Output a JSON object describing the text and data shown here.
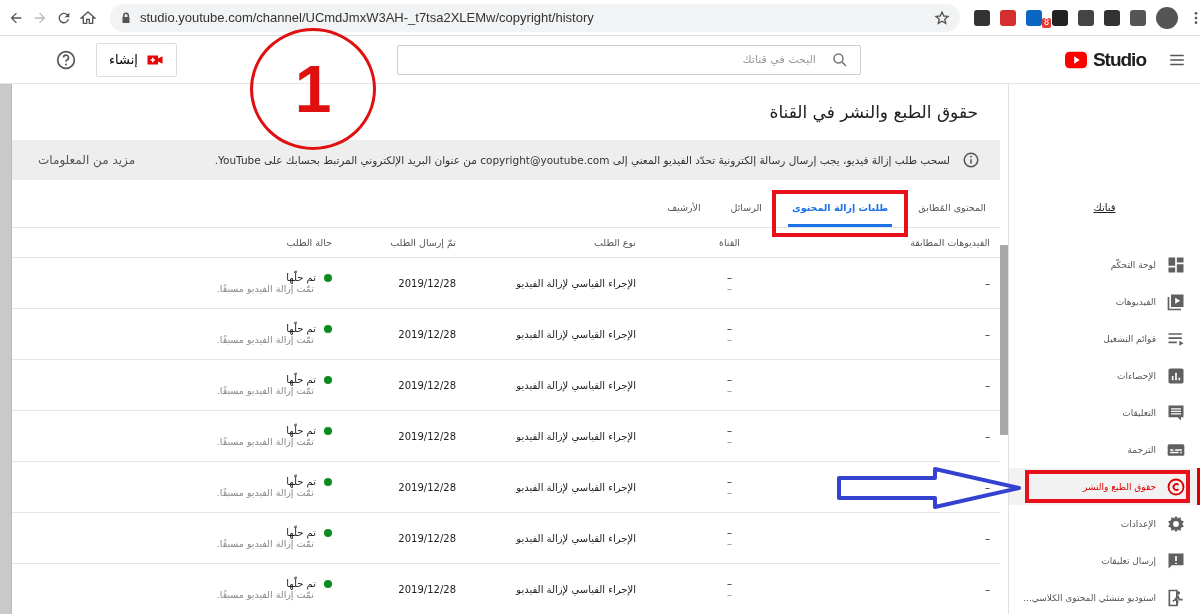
{
  "browser": {
    "url": "studio.youtube.com/channel/UCmdJmxW3AH-_t7tsa2XLEMw/copyright/history",
    "extension_badge": "8"
  },
  "header": {
    "logo_text": "Studio",
    "search": {
      "placeholder": "البحث في قناتك"
    },
    "create_button": "إنشاء"
  },
  "page": {
    "title": "حقوق الطبع والنشر في القناة",
    "info": "لسحب طلب إزالة فيديو، يجب إرسال رسالة إلكترونية تحدّد الفيديو المعني إلى copyright@youtube.com من عنوان البريد الإلكتروني المرتبط بحسابك على YouTube.",
    "more_info": "مزيد من المعلومات"
  },
  "tabs": [
    {
      "label": "المحتوى المُطابق",
      "selected": false
    },
    {
      "label": "طلبات إزالة المحتوى",
      "selected": true
    },
    {
      "label": "الرسائل",
      "selected": false
    },
    {
      "label": "الأرشيف",
      "selected": false
    }
  ],
  "table": {
    "columns": [
      "الفيديوهات المطابقة",
      "القناة",
      "نوع الطلب",
      "تمّ إرسال الطلب",
      "حالة الطلب"
    ],
    "rows": [
      {
        "matched_video": "–",
        "channel": "–",
        "channel_sub": "–",
        "type": "الإجراء القياسي لإزالة الفيديو",
        "date": "2019/12/28",
        "status": "تم حلّها",
        "status_note": "تمّت إزالة الفيديو مسبقًا."
      },
      {
        "matched_video": "–",
        "channel": "–",
        "channel_sub": "–",
        "type": "الإجراء القياسي لإزالة الفيديو",
        "date": "2019/12/28",
        "status": "تم حلّها",
        "status_note": "تمّت إزالة الفيديو مسبقًا."
      },
      {
        "matched_video": "–",
        "channel": "–",
        "channel_sub": "–",
        "type": "الإجراء القياسي لإزالة الفيديو",
        "date": "2019/12/28",
        "status": "تم حلّها",
        "status_note": "تمّت إزالة الفيديو مسبقًا."
      },
      {
        "matched_video": "–",
        "channel": "–",
        "channel_sub": "–",
        "type": "الإجراء القياسي لإزالة الفيديو",
        "date": "2019/12/28",
        "status": "تم حلّها",
        "status_note": "تمّت إزالة الفيديو مسبقًا."
      },
      {
        "matched_video": "–",
        "channel": "–",
        "channel_sub": "–",
        "type": "الإجراء القياسي لإزالة الفيديو",
        "date": "2019/12/28",
        "status": "تم حلّها",
        "status_note": "تمّت إزالة الفيديو مسبقًا."
      },
      {
        "matched_video": "–",
        "channel": "–",
        "channel_sub": "–",
        "type": "الإجراء القياسي لإزالة الفيديو",
        "date": "2019/12/28",
        "status": "تم حلّها",
        "status_note": "تمّت إزالة الفيديو مسبقًا."
      },
      {
        "matched_video": "–",
        "channel": "–",
        "channel_sub": "–",
        "type": "الإجراء القياسي لإزالة الفيديو",
        "date": "2019/12/28",
        "status": "تم حلّها",
        "status_note": "تمّت إزالة الفيديو مسبقًا."
      }
    ]
  },
  "sidebar": {
    "channel_label": "قناتك",
    "items": [
      {
        "label": "لوحة التحكّم",
        "selected": false
      },
      {
        "label": "الفيديوهات",
        "selected": false
      },
      {
        "label": "قوائم التشغيل",
        "selected": false
      },
      {
        "label": "الإحصاءات",
        "selected": false
      },
      {
        "label": "التعليقات",
        "selected": false
      },
      {
        "label": "الترجمة",
        "selected": false
      },
      {
        "label": "حقوق الطبع والنشر",
        "selected": true
      },
      {
        "label": "الإعدادات",
        "selected": false
      },
      {
        "label": "إرسال تعليقات",
        "selected": false
      },
      {
        "label": "استوديو منشئي المحتوى الكلاسي...",
        "selected": false
      }
    ]
  },
  "annotation": {
    "step_number": "1"
  }
}
